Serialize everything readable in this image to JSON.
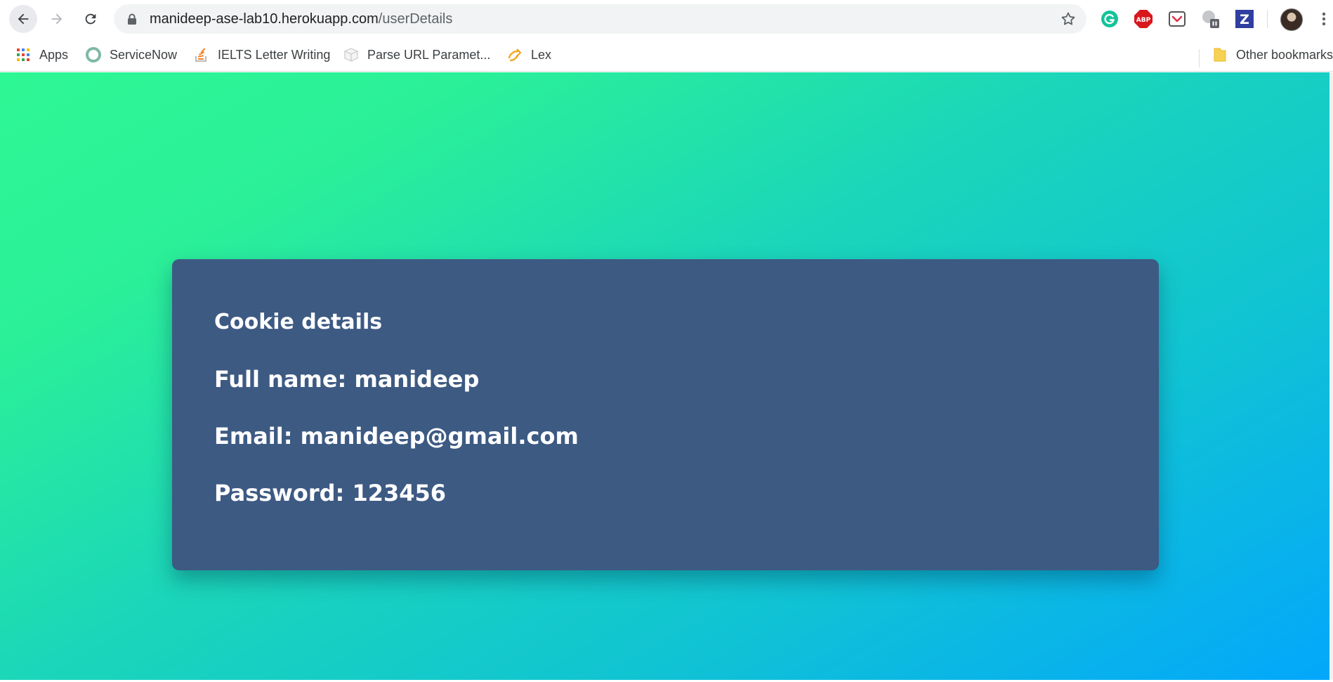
{
  "browser": {
    "url_host": "manideep-ase-lab10.herokuapp.com",
    "url_path": "/userDetails"
  },
  "bookmarks": {
    "items": [
      {
        "label": "Apps"
      },
      {
        "label": "ServiceNow"
      },
      {
        "label": "IELTS Letter Writing"
      },
      {
        "label": "Parse URL Paramet..."
      },
      {
        "label": "Lex"
      }
    ],
    "other_label": "Other bookmarks"
  },
  "extensions": {
    "abp_label": "ABP",
    "z_label": "Z"
  },
  "card": {
    "title": "Cookie details",
    "full_name_line": "Full name: manideep",
    "email_line": "Email: manideep@gmail.com",
    "password_line": "Password: 123456"
  },
  "colors": {
    "card_background": "#3d5a83",
    "gradient_start": "#2ef795",
    "gradient_end": "#03a7fb",
    "card_text": "#ffffff"
  }
}
